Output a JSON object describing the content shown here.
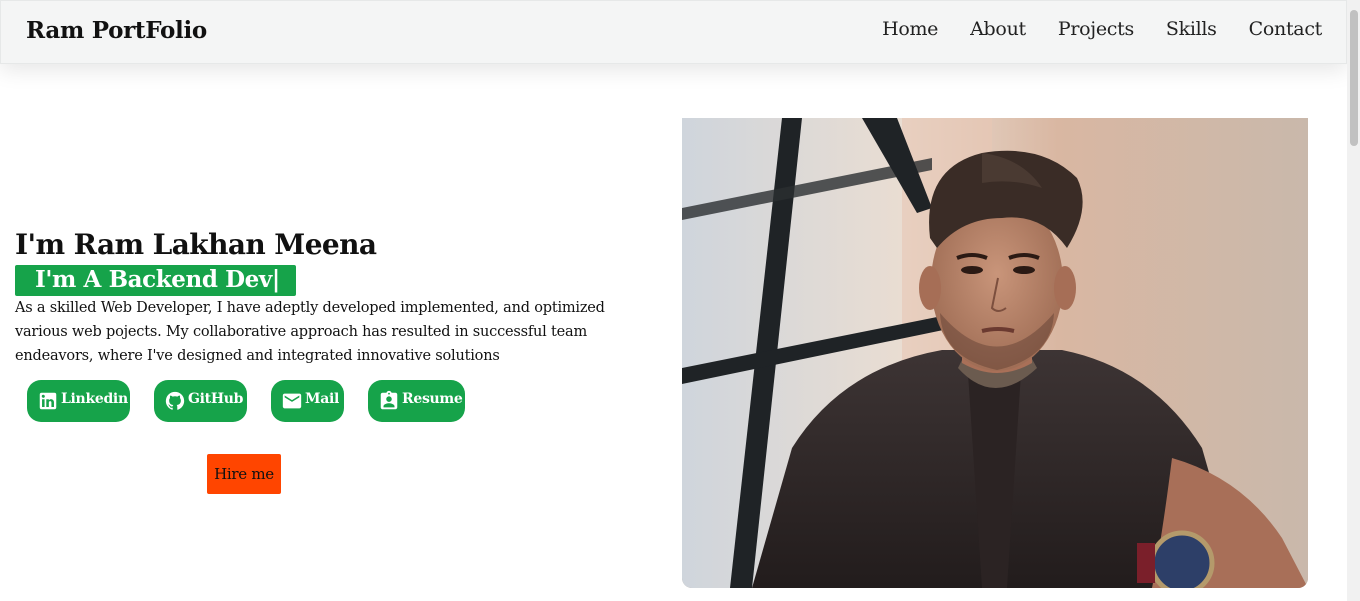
{
  "navbar": {
    "brand": "Ram PortFolio",
    "links": [
      "Home",
      "About",
      "Projects",
      "Skills",
      "Contact"
    ]
  },
  "hero": {
    "title": "I'm Ram Lakhan Meena",
    "role": "I'm A Backend Dev|",
    "bio": "As a skilled Web Developer, I have adeptly developed implemented, and optimized various web pojects. My collaborative approach has resulted in successful team endeavors, where I've designed and integrated innovative solutions",
    "social": [
      {
        "label": "Linkedin",
        "icon": "linkedin-icon"
      },
      {
        "label": "GitHub",
        "icon": "github-icon"
      },
      {
        "label": "Mail",
        "icon": "mail-icon"
      },
      {
        "label": "Resume",
        "icon": "resume-icon"
      }
    ],
    "hire_label": "Hire me"
  },
  "colors": {
    "accent_green": "#16a34a",
    "hire_orange": "#ff4500",
    "navbar_bg": "#f4f5f5"
  }
}
